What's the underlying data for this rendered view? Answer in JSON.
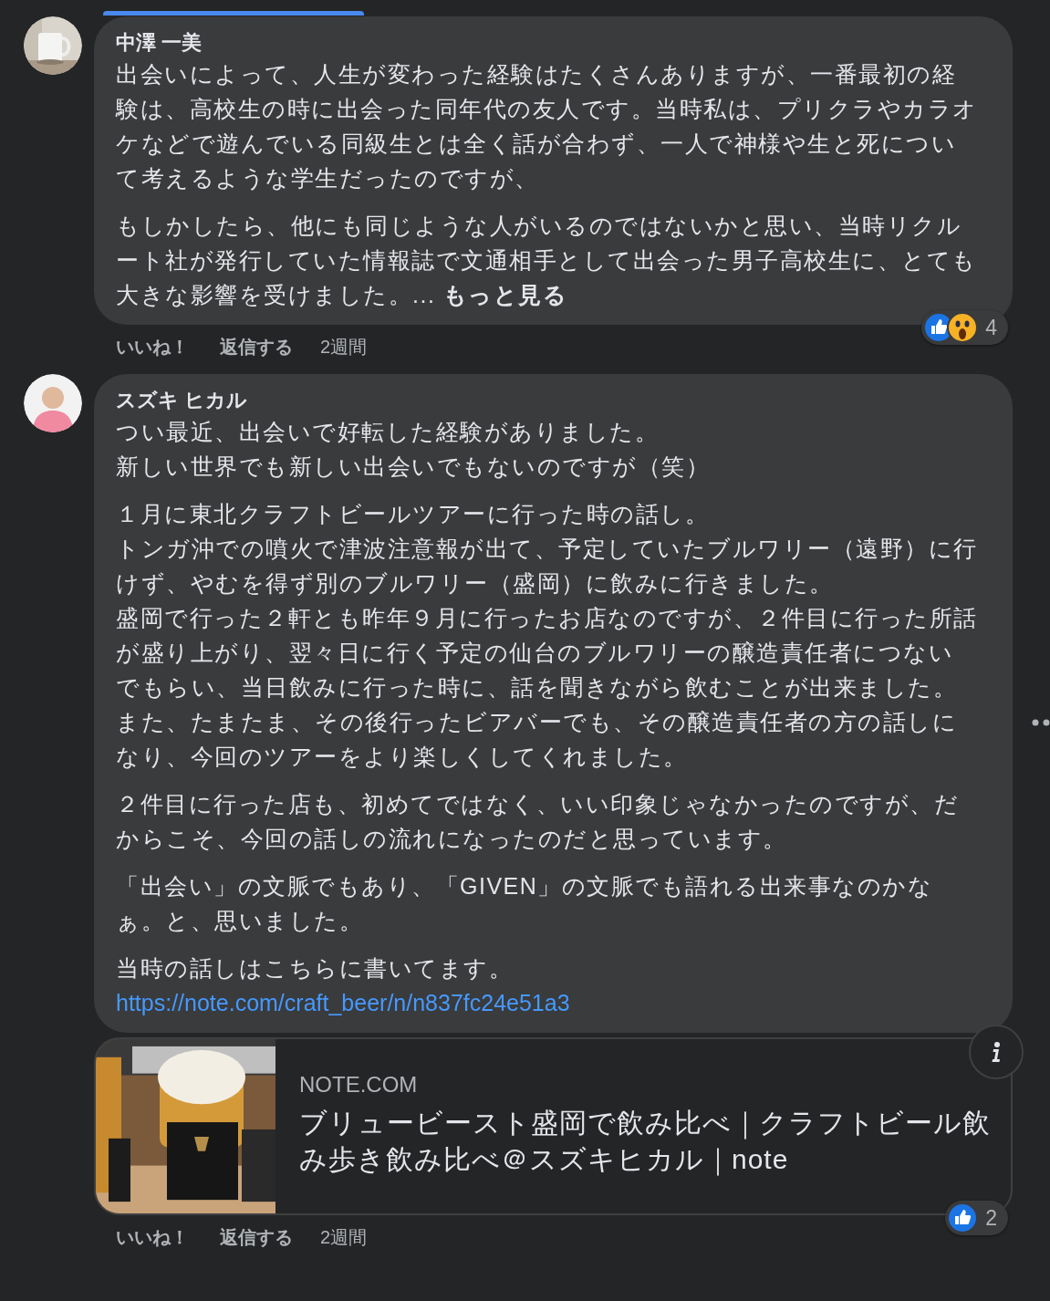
{
  "comments": [
    {
      "author": "中澤 一美",
      "avatar": {
        "kind": "picture"
      },
      "paragraphs": [
        [
          "出会いによって、人生が変わった経験はたくさんありますが、一番最初の経験は、高校生の時に出会った同年代の友人です。当時私は、プリクラやカラオケなどで遊んでいる同級生とは全く話が合わず、一人で神様や生と死について考えるような学生だったのですが、"
        ],
        [
          "もしかしたら、他にも同じような人がいるのではないかと思い、当時リクルート社が発行していた情報誌で文通相手として出会った男子高校生に、とても大きな影響を受けました。..."
        ]
      ],
      "see_more": "もっと見る",
      "reactions": [
        {
          "kind": "like"
        },
        {
          "kind": "wow"
        }
      ],
      "reaction_count": "4",
      "actions": [
        "いいね！",
        "返信する"
      ],
      "time": "2週間"
    },
    {
      "author": "スズキ ヒカル",
      "avatar": {
        "kind": "person"
      },
      "paragraphs": [
        [
          "つい最近、出会いで好転した経験がありました。",
          "新しい世界でも新しい出会いでもないのですが（笑）"
        ],
        [
          "１月に東北クラフトビールツアーに行った時の話し。",
          "トンガ沖での噴火で津波注意報が出て、予定していたブルワリー（遠野）に行けず、やむを得ず別のブルワリー（盛岡）に飲みに行きました。",
          "盛岡で行った２軒とも昨年９月に行ったお店なのですが、２件目に行った所話が盛り上がり、翌々日に行く予定の仙台のブルワリーの醸造責任者につないでもらい、当日飲みに行った時に、話を聞きながら飲むことが出来ました。",
          "また、たまたま、その後行ったビアバーでも、その醸造責任者の方の話しになり、今回のツアーをより楽しくしてくれました。"
        ],
        [
          "２件目に行った店も、初めてではなく、いい印象じゃなかったのですが、だからこそ、今回の話しの流れになったのだと思っています。"
        ],
        [
          "「出会い」の文脈でもあり、「GIVEN」の文脈でも語れる出来事なのかなぁ。と、思いました。"
        ],
        [
          "当時の話しはこちらに書いてます。"
        ]
      ],
      "link": "https://note.com/craft_beer/n/n837fc24e51a3",
      "link_preview": {
        "image": {
          "kind": "picture"
        },
        "domain": "NOTE.COM",
        "title": "ブリュービースト盛岡で飲み比べ｜クラフトビール飲み歩き飲み比べ＠スズキヒカル｜note"
      },
      "reactions": [
        {
          "kind": "like"
        }
      ],
      "reaction_count": "2",
      "actions": [
        "いいね！",
        "返信する"
      ],
      "time": "2週間"
    }
  ]
}
